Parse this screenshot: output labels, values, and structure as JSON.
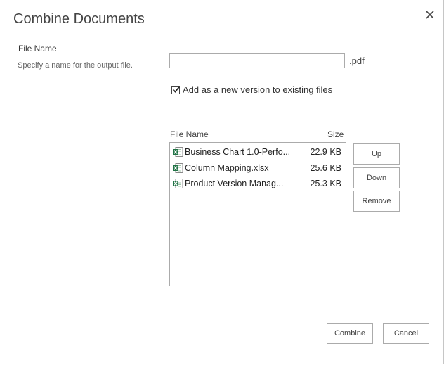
{
  "dialog": {
    "title": "Combine Documents",
    "file_name_label": "File Name",
    "file_name_description": "Specify a name for the output file.",
    "file_name_value": "",
    "extension": ".pdf",
    "new_version_checked": true,
    "new_version_label": "Add as a new version to existing files"
  },
  "file_list": {
    "columns": {
      "name": "File Name",
      "size": "Size"
    },
    "files": [
      {
        "name": "Business Chart 1.0-Perfo...",
        "size": "22.9 KB",
        "icon": "excel-file-icon"
      },
      {
        "name": "Column Mapping.xlsx",
        "size": "25.6 KB",
        "icon": "excel-file-icon"
      },
      {
        "name": "Product Version Manag...",
        "size": "25.3 KB",
        "icon": "excel-file-icon"
      }
    ]
  },
  "buttons": {
    "up": "Up",
    "down": "Down",
    "remove": "Remove",
    "combine": "Combine",
    "cancel": "Cancel"
  },
  "colors": {
    "excel_green": "#217346",
    "border": "#ababab"
  }
}
